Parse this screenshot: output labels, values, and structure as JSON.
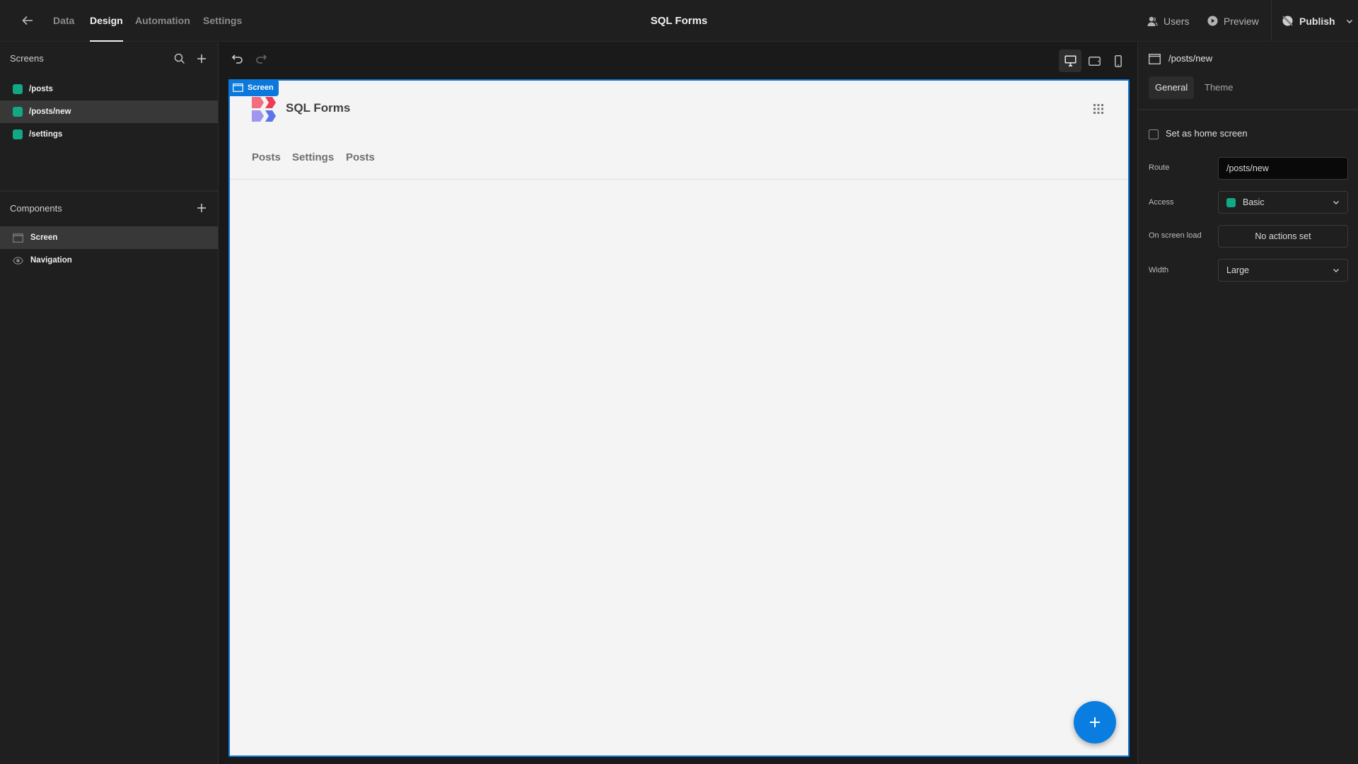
{
  "topbar": {
    "back_icon": "arrow-left-icon",
    "nav": [
      {
        "label": "Data",
        "active": false
      },
      {
        "label": "Design",
        "active": true
      },
      {
        "label": "Automation",
        "active": false
      },
      {
        "label": "Settings",
        "active": false
      }
    ],
    "app_title": "SQL Forms",
    "users_label": "Users",
    "preview_label": "Preview",
    "publish_label": "Publish"
  },
  "sidebar": {
    "screens_title": "Screens",
    "screens": [
      {
        "label": "/posts",
        "color": "#12a884",
        "selected": false
      },
      {
        "label": "/posts/new",
        "color": "#12a884",
        "selected": true
      },
      {
        "label": "/settings",
        "color": "#12a884",
        "selected": false
      }
    ],
    "components_title": "Components",
    "components": [
      {
        "label": "Screen",
        "icon": "screen-icon",
        "selected": true
      },
      {
        "label": "Navigation",
        "icon": "eye-icon",
        "selected": false
      }
    ]
  },
  "canvas": {
    "screen_tag": "Screen",
    "app_name": "SQL Forms",
    "nav_links": [
      "Posts",
      "Settings",
      "Posts"
    ],
    "accent": "#0a78dc"
  },
  "props": {
    "title": "/posts/new",
    "tabs": [
      {
        "label": "General",
        "active": true
      },
      {
        "label": "Theme",
        "active": false
      }
    ],
    "home_screen_label": "Set as home screen",
    "home_screen_checked": false,
    "route_label": "Route",
    "route_value": "/posts/new",
    "access_label": "Access",
    "access_value": "Basic",
    "access_color": "#12a884",
    "onload_label": "On screen load",
    "onload_value": "No actions set",
    "width_label": "Width",
    "width_value": "Large"
  }
}
